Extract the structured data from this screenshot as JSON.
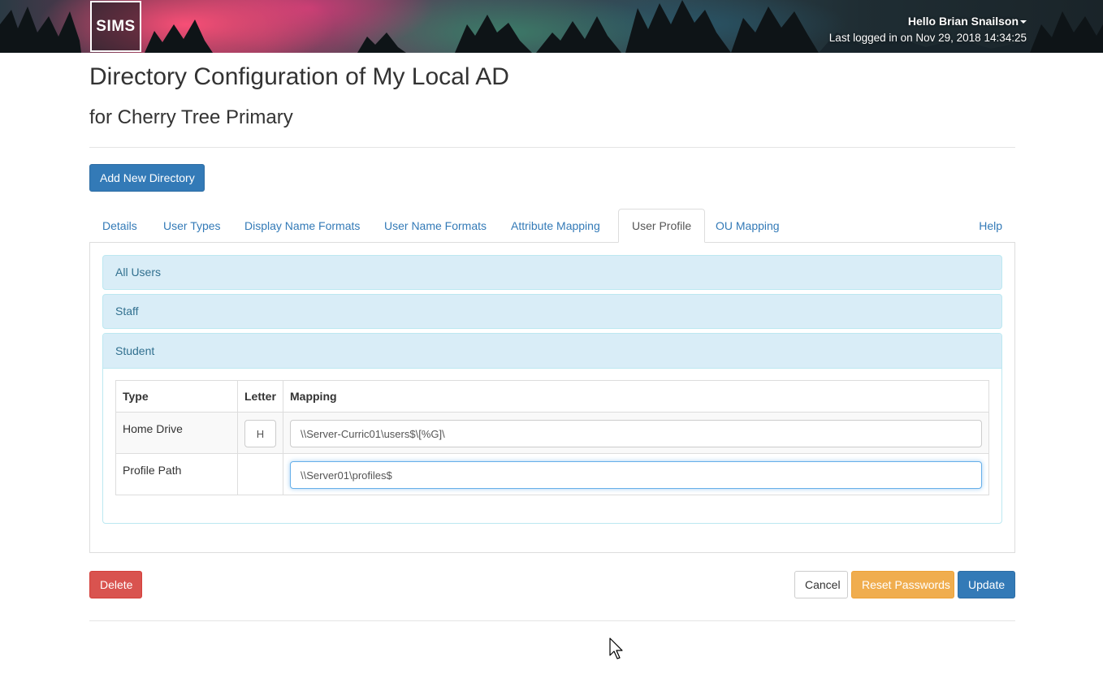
{
  "header": {
    "logo_text": "SIMS",
    "greeting": "Hello Brian Snailson",
    "last_logged_in": "Last logged in on Nov 29, 2018 14:34:25"
  },
  "page": {
    "title": "Directory Configuration of My Local AD",
    "subtitle": "for Cherry Tree Primary",
    "add_button_label": "Add New Directory"
  },
  "tabs": {
    "items": [
      {
        "label": "Details"
      },
      {
        "label": "User Types"
      },
      {
        "label": "Display Name Formats"
      },
      {
        "label": "User Name Formats"
      },
      {
        "label": "Attribute Mapping"
      },
      {
        "label": "User Profile",
        "active": true
      },
      {
        "label": "OU Mapping"
      }
    ],
    "help_label": "Help"
  },
  "accordion": {
    "sections": [
      {
        "label": "All Users"
      },
      {
        "label": "Staff"
      },
      {
        "label": "Student",
        "expanded": true
      }
    ]
  },
  "profile_table": {
    "headers": [
      "Type",
      "Letter",
      "Mapping"
    ],
    "rows": [
      {
        "type": "Home Drive",
        "letter": "H",
        "mapping": "\\\\Server-Curric01\\users$\\[%G]\\"
      },
      {
        "type": "Profile Path",
        "letter": "",
        "mapping": "\\\\Server01\\profiles$"
      }
    ]
  },
  "footer_buttons": {
    "delete_label": "Delete",
    "cancel_label": "Cancel",
    "reset_label": "Reset Passwords",
    "update_label": "Update"
  },
  "colors": {
    "primary": "#337ab7",
    "danger": "#d9534f",
    "warning": "#f0ad4e",
    "panel_info_bg": "#d9edf7",
    "panel_info_text": "#31708f"
  }
}
